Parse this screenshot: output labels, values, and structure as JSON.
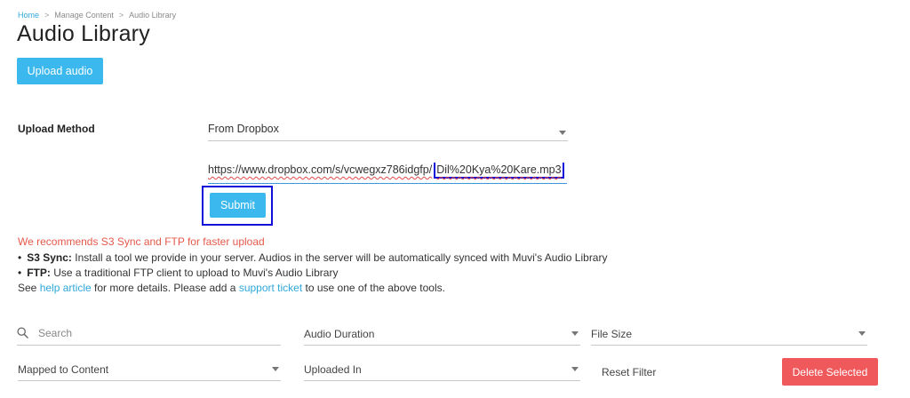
{
  "breadcrumb": {
    "home": "Home",
    "sep": ">",
    "manage": "Manage Content",
    "current": "Audio Library"
  },
  "page_title": "Audio Library",
  "upload_button": "Upload audio",
  "upload_method": {
    "label": "Upload Method",
    "selected": "From Dropbox"
  },
  "url_input": {
    "text_main": "https://www.dropbox.com/s/vcwegxz786idgfp/",
    "text_highlight": "Dil%20Kya%20Kare.mp3"
  },
  "submit_button": "Submit",
  "notice": "We recommends S3 Sync and FTP for faster upload",
  "bullets": [
    {
      "term": "S3 Sync:",
      "text": " Install a tool we provide in your server. Audios in the server will be automatically synced with Muvi's Audio Library"
    },
    {
      "term": "FTP:",
      "text": " Use a traditional FTP client to upload to Muvi's Audio Library"
    }
  ],
  "see_line": {
    "pre": "See ",
    "link1": "help article",
    "mid": " for more details. Please add a ",
    "link2": "support ticket",
    "post": " to use one of the above tools."
  },
  "filters": {
    "search_placeholder": "Search",
    "duration": "Audio Duration",
    "file_size": "File Size",
    "mapped": "Mapped to Content",
    "uploaded_in": "Uploaded In",
    "reset": "Reset Filter",
    "delete": "Delete Selected"
  },
  "colors": {
    "accent": "#3bb8ee",
    "danger": "#f0595b",
    "notice": "#e45a4a",
    "highlight_box": "#1010d8"
  },
  "icons": {
    "search": "search-icon",
    "dropdown": "chevron-down-icon"
  }
}
